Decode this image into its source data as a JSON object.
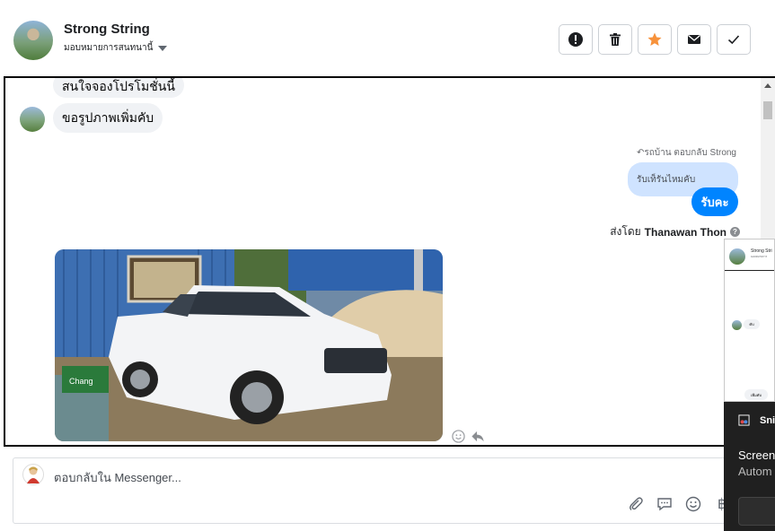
{
  "header": {
    "contact_name": "Strong String",
    "assign_label": "มอบหมายการสนทนานี้",
    "actions": [
      {
        "name": "report-spam",
        "icon": "exclamation-icon"
      },
      {
        "name": "delete",
        "icon": "trash-icon"
      },
      {
        "name": "star",
        "icon": "star-icon",
        "color": "#f7923b"
      },
      {
        "name": "mark-unread",
        "icon": "envelope-icon"
      },
      {
        "name": "mark-done",
        "icon": "check-icon"
      }
    ]
  },
  "conversation": {
    "incoming": [
      {
        "text": "สนใจจองโปรโมชั่นนี้"
      },
      {
        "text": "ขอรูปภาพเพิ่มคับ"
      }
    ],
    "reply_header": "รถบ้าน ตอบกลับ Strong",
    "quoted_text": "รับเท็รันไหมคับ",
    "outgoing_text": "รับคะ",
    "sent_by_prefix": "ส่งโดย",
    "sent_by_name": "Thanawan Thon",
    "photo_alt": "white pickup truck"
  },
  "composer": {
    "placeholder": "ตอบกลับใน Messenger...",
    "tools": [
      "paperclip-icon",
      "chat-bubble-icon",
      "smiley-icon",
      "baht-icon"
    ],
    "baht_symbol": "฿"
  },
  "snip_overlay": {
    "preview_name": "Strong Stri",
    "preview_sub": "มอบหมายการ",
    "preview_bubble_1": "คับ",
    "preview_bubble_2": "เพิ่มคับ",
    "app_name": "Sni",
    "line1": "Screen",
    "line2": "Autom"
  },
  "colors": {
    "accent": "#0084ff",
    "quoted_bg": "#cfe3ff",
    "star": "#f7923b"
  }
}
